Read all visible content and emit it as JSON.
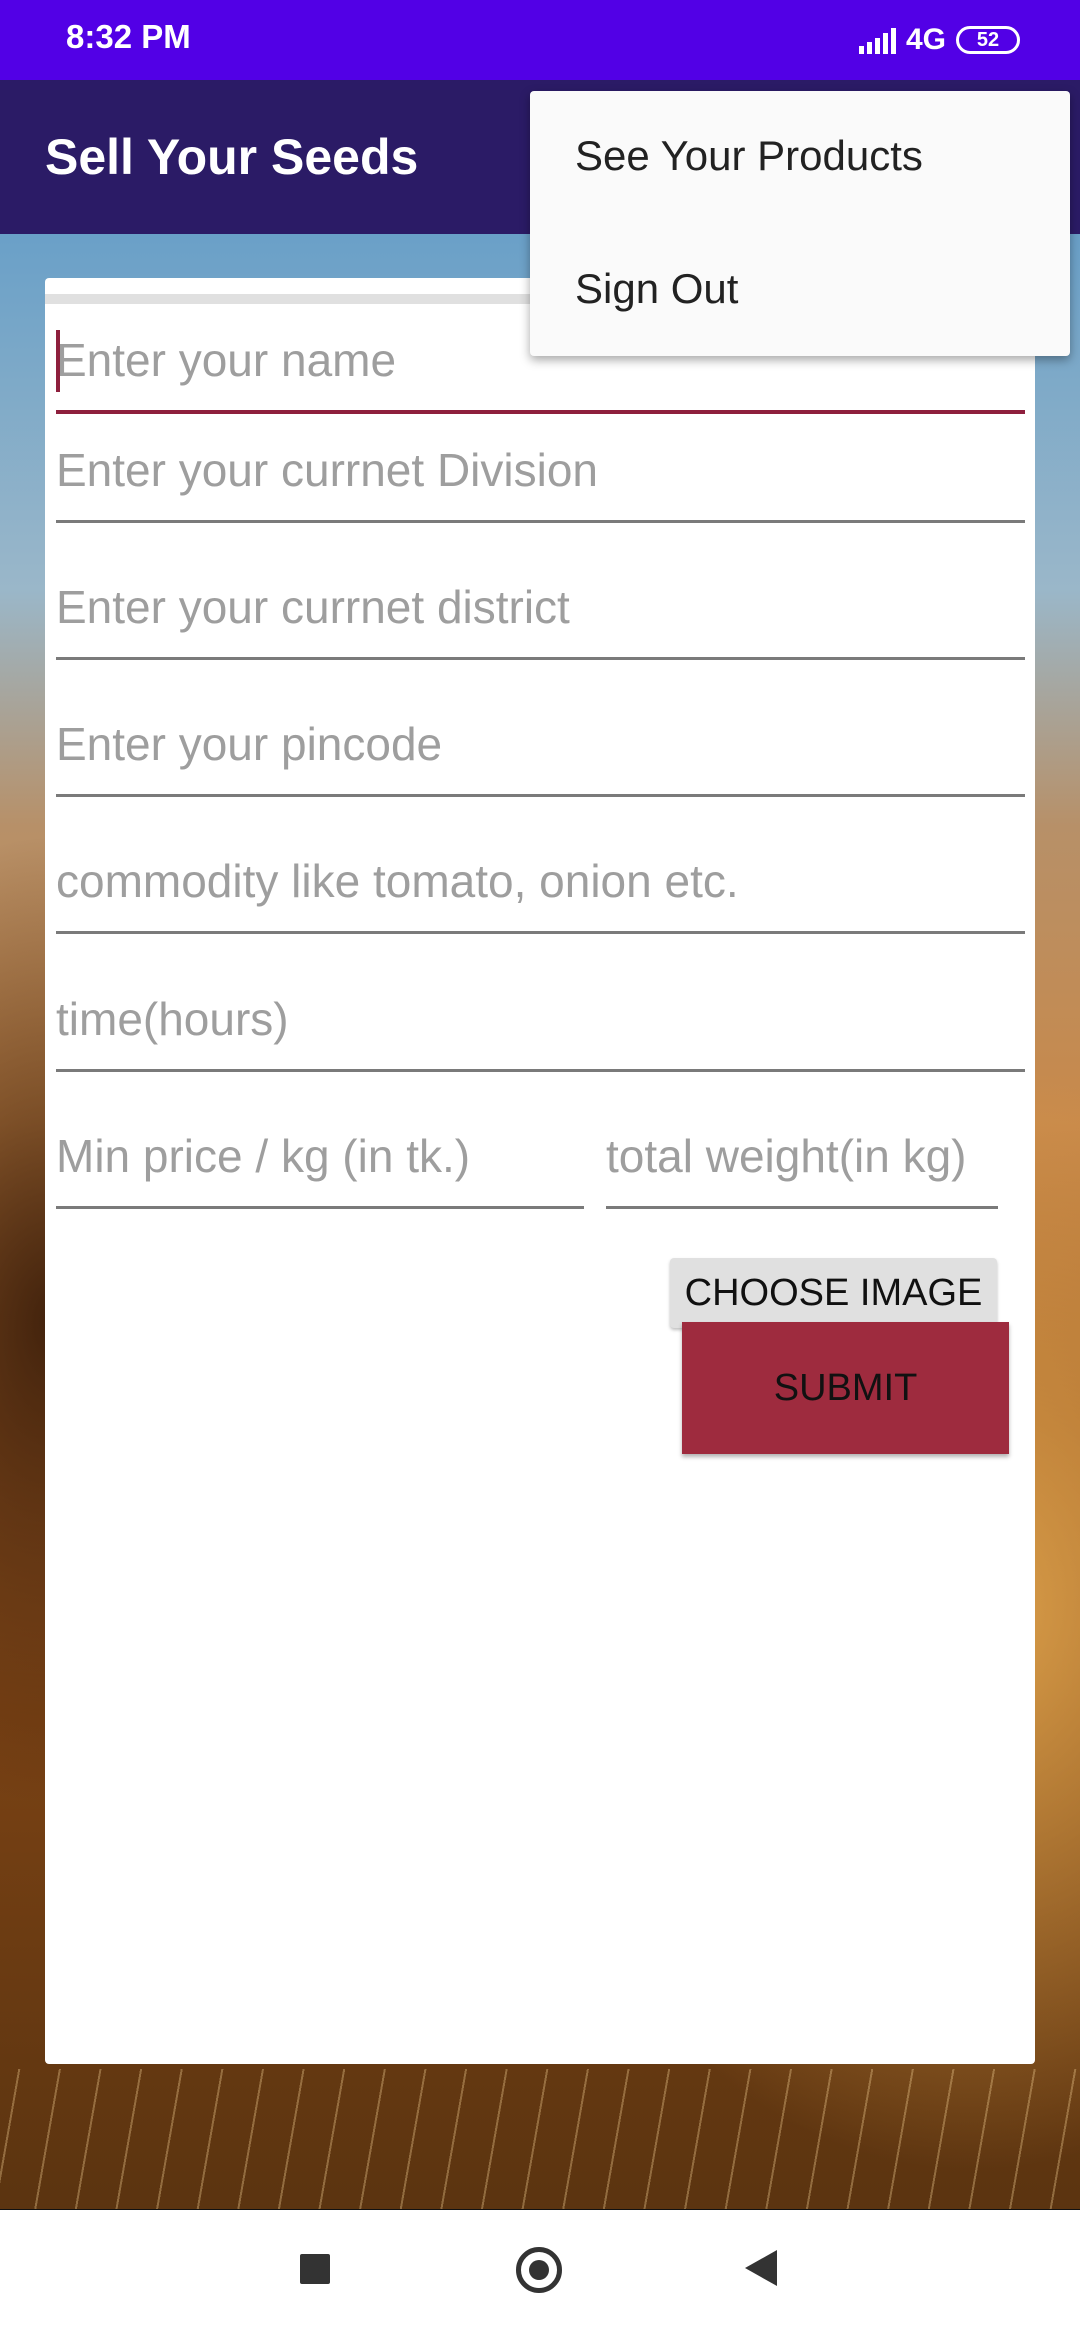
{
  "status_bar": {
    "time": "8:32 PM",
    "network": "4G",
    "battery": "52"
  },
  "app_bar": {
    "title": "Sell Your Seeds"
  },
  "menu": {
    "items": [
      {
        "label": "See Your Products"
      },
      {
        "label": "Sign Out"
      }
    ]
  },
  "form": {
    "name_placeholder": "Enter your name",
    "division_placeholder": "Enter your currnet Division",
    "district_placeholder": "Enter your currnet district",
    "pincode_placeholder": "Enter your pincode",
    "commodity_placeholder": "commodity like tomato, onion etc.",
    "time_placeholder": "time(hours)",
    "min_price_placeholder": "Min price / kg (in tk.)",
    "weight_placeholder": "total weight(in kg)",
    "choose_image_label": "CHOOSE IMAGE",
    "submit_label": "SUBMIT"
  },
  "colors": {
    "status_bar": "#5200e6",
    "app_bar": "#2b1b66",
    "accent": "#8e1f3d",
    "submit": "#9e2b3e"
  },
  "icons": {
    "signal": "signal-icon",
    "battery": "battery-icon",
    "nav_recent": "square-icon",
    "nav_home": "circle-icon",
    "nav_back": "triangle-back-icon"
  }
}
